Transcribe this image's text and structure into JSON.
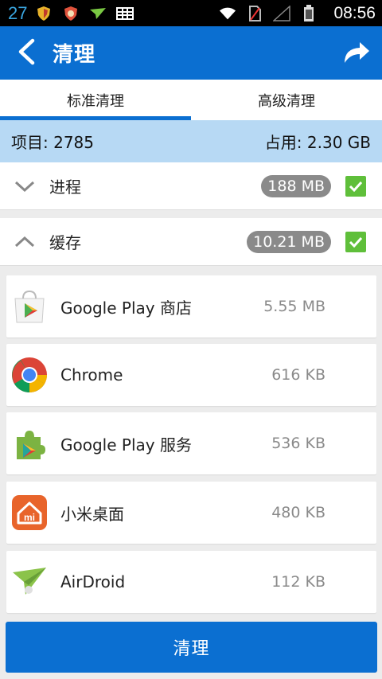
{
  "status_bar": {
    "notification_count": "27",
    "time": "08:56",
    "icons": [
      "shield-icon",
      "shield-red-icon",
      "airdroid-icon",
      "message-icon",
      "wifi-icon",
      "no-sim-icon",
      "signal-icon",
      "battery-icon"
    ]
  },
  "app_bar": {
    "title": "清理",
    "back_icon": "back-arrow-icon",
    "share_icon": "share-arrow-icon",
    "color": "#0b6fd1"
  },
  "tabs": [
    {
      "label": "标准清理",
      "active": true
    },
    {
      "label": "高级清理",
      "active": false
    }
  ],
  "summary": {
    "items_label": "项目: 2785",
    "usage_label": "占用: 2.30 GB"
  },
  "groups": [
    {
      "label": "进程",
      "size": "188 MB",
      "expanded": false,
      "checked": true
    },
    {
      "label": "缓存",
      "size": "10.21 MB",
      "expanded": true,
      "checked": true
    }
  ],
  "apps": [
    {
      "name": "Google Play 商店",
      "size": "5.55 MB",
      "icon": "google-play-store-icon"
    },
    {
      "name": "Chrome",
      "size": "616 KB",
      "icon": "chrome-icon"
    },
    {
      "name": "Google Play 服务",
      "size": "536 KB",
      "icon": "google-play-services-icon"
    },
    {
      "name": "小米桌面",
      "size": "480 KB",
      "icon": "mi-launcher-icon",
      "icon_text": "mi"
    },
    {
      "name": "AirDroid",
      "size": "112 KB",
      "icon": "airdroid-icon"
    }
  ],
  "clean_button": {
    "label": "清理"
  }
}
